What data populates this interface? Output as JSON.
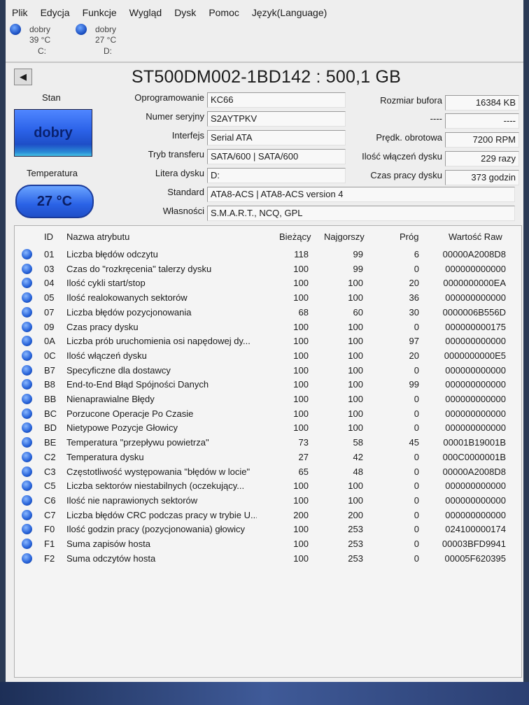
{
  "menu": [
    "Plik",
    "Edycja",
    "Funkcje",
    "Wygląd",
    "Dysk",
    "Pomoc",
    "Język(Language)"
  ],
  "drives": [
    {
      "status": "dobry",
      "temp": "39 °C",
      "letter": "C:"
    },
    {
      "status": "dobry",
      "temp": "27 °C",
      "letter": "D:"
    }
  ],
  "title": "ST500DM002-1BD142 : 500,1 GB",
  "left": {
    "stan_label": "Stan",
    "health": "dobry",
    "temp_label": "Temperatura",
    "temp": "27 °C"
  },
  "info": {
    "firmware": {
      "label": "Oprogramowanie",
      "value": "KC66"
    },
    "serial": {
      "label": "Numer seryjny",
      "value": "S2AYTPKV"
    },
    "interface": {
      "label": "Interfejs",
      "value": "Serial ATA"
    },
    "transfer": {
      "label": "Tryb transferu",
      "value": "SATA/600 | SATA/600"
    },
    "letter": {
      "label": "Litera dysku",
      "value": "D:"
    },
    "standard": {
      "label": "Standard",
      "value": "ATA8-ACS | ATA8-ACS version 4"
    },
    "features": {
      "label": "Własności",
      "value": "S.M.A.R.T., NCQ, GPL"
    },
    "buffer": {
      "label": "Rozmiar bufora",
      "value": "16384 KB"
    },
    "blank": {
      "label": "----",
      "value": "----"
    },
    "rpm": {
      "label": "Prędk. obrotowa",
      "value": "7200 RPM"
    },
    "power_count": {
      "label": "Ilość włączeń dysku",
      "value": "229 razy"
    },
    "power_hours": {
      "label": "Czas pracy dysku",
      "value": "373 godzin"
    }
  },
  "table": {
    "headers": [
      "ID",
      "Nazwa atrybutu",
      "Bieżący",
      "Najgorszy",
      "Próg",
      "Wartość Raw"
    ],
    "rows": [
      [
        "01",
        "Liczba błędów odczytu",
        "118",
        "99",
        "6",
        "00000A2008D8"
      ],
      [
        "03",
        "Czas do \"rozkręcenia\" talerzy dysku",
        "100",
        "99",
        "0",
        "000000000000"
      ],
      [
        "04",
        "Ilość cykli start/stop",
        "100",
        "100",
        "20",
        "0000000000EA"
      ],
      [
        "05",
        "Ilość realokowanych sektorów",
        "100",
        "100",
        "36",
        "000000000000"
      ],
      [
        "07",
        "Liczba błędów pozycjonowania",
        "68",
        "60",
        "30",
        "0000006B556D"
      ],
      [
        "09",
        "Czas pracy dysku",
        "100",
        "100",
        "0",
        "000000000175"
      ],
      [
        "0A",
        "Liczba prób uruchomienia osi napędowej dy...",
        "100",
        "100",
        "97",
        "000000000000"
      ],
      [
        "0C",
        "Ilość włączeń dysku",
        "100",
        "100",
        "20",
        "0000000000E5"
      ],
      [
        "B7",
        "Specyficzne dla dostawcy",
        "100",
        "100",
        "0",
        "000000000000"
      ],
      [
        "B8",
        "End-to-End Błąd Spójności Danych",
        "100",
        "100",
        "99",
        "000000000000"
      ],
      [
        "BB",
        "Nienaprawialne Błędy",
        "100",
        "100",
        "0",
        "000000000000"
      ],
      [
        "BC",
        "Porzucone Operacje Po Czasie",
        "100",
        "100",
        "0",
        "000000000000"
      ],
      [
        "BD",
        "Nietypowe Pozycje Głowicy",
        "100",
        "100",
        "0",
        "000000000000"
      ],
      [
        "BE",
        "Temperatura \"przepływu powietrza\"",
        "73",
        "58",
        "45",
        "00001B19001B"
      ],
      [
        "C2",
        "Temperatura dysku",
        "27",
        "42",
        "0",
        "000C0000001B"
      ],
      [
        "C3",
        "Częstotliwość występowania \"błędów w locie\"",
        "65",
        "48",
        "0",
        "00000A2008D8"
      ],
      [
        "C5",
        "Liczba sektorów niestabilnych (oczekujący...",
        "100",
        "100",
        "0",
        "000000000000"
      ],
      [
        "C6",
        "Ilość nie naprawionych sektorów",
        "100",
        "100",
        "0",
        "000000000000"
      ],
      [
        "C7",
        "Liczba błędów CRC podczas pracy w trybie U...",
        "200",
        "200",
        "0",
        "000000000000"
      ],
      [
        "F0",
        "Ilość godzin pracy (pozycjonowania) głowicy",
        "100",
        "253",
        "0",
        "024100000174"
      ],
      [
        "F1",
        "Suma zapisów hosta",
        "100",
        "253",
        "0",
        "00003BFD9941"
      ],
      [
        "F2",
        "Suma odczytów hosta",
        "100",
        "253",
        "0",
        "00005F620395"
      ]
    ]
  }
}
